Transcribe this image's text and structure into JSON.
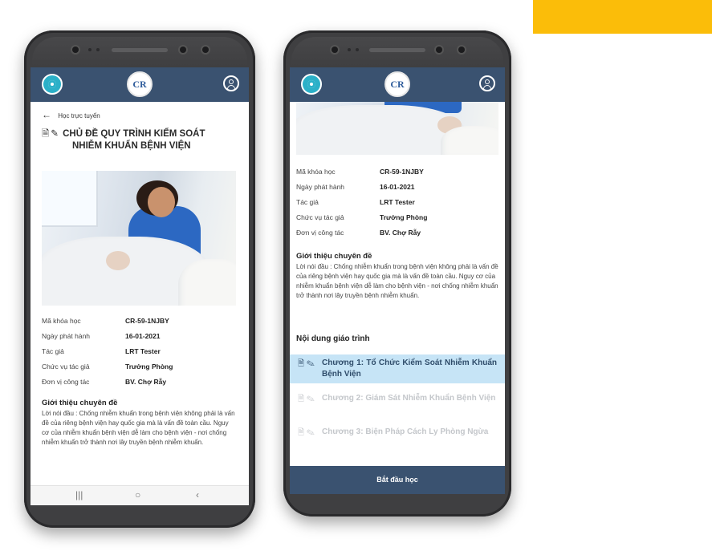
{
  "colors": {
    "accent": "#fbbd09",
    "header": "#3a5270",
    "active_chapter": "#c6e4f6"
  },
  "logo_center_text": "CR",
  "left_screen": {
    "back_label": "Học trực tuyến",
    "title_line1": "CHỦ ĐỀ QUY TRÌNH KIỂM SOÁT",
    "title_line2": "NHIỄM KHUẨN BỆNH VIỆN",
    "info": [
      {
        "label": "Mã khóa học",
        "value": "CR-59-1NJBY"
      },
      {
        "label": "Ngày phát hành",
        "value": "16-01-2021"
      },
      {
        "label": "Tác giả",
        "value": "LRT Tester"
      },
      {
        "label": "Chức vụ tác giả",
        "value": "Trưởng Phòng"
      },
      {
        "label": "Đơn vị công tác",
        "value": "BV. Chợ Rẫy"
      }
    ],
    "intro_heading": "Giới thiệu chuyên đề",
    "intro_text": "Lời nói đầu : Chống nhiễm khuẩn trong bệnh viện không phải là vấn đề của riêng bệnh viện hay quốc gia mà là vấn đề toàn cầu. Nguy cơ của nhiễm khuẩn bệnh viện dễ làm cho bệnh viện - nơi chống nhiễm khuẩn trở thành nơi lây truyền bệnh nhiễm khuẩn.",
    "nav": {
      "recent": "|||",
      "home": "○",
      "back": "‹"
    }
  },
  "right_screen": {
    "info": [
      {
        "label": "Mã khóa học",
        "value": "CR-59-1NJBY"
      },
      {
        "label": "Ngày phát hành",
        "value": "16-01-2021"
      },
      {
        "label": "Tác giả",
        "value": "LRT Tester"
      },
      {
        "label": "Chức vụ tác giả",
        "value": "Trưởng Phòng"
      },
      {
        "label": "Đơn vị công tác",
        "value": "BV. Chợ Rẫy"
      }
    ],
    "intro_heading": "Giới thiệu chuyên đề",
    "intro_text": "Lời nói đầu : Chống nhiễm khuẩn trong bệnh viện không phải là vấn đề của riêng bệnh viện hay quốc gia mà là vấn đề toàn cầu. Nguy cơ của nhiễm khuẩn bệnh viện dễ làm cho bệnh viện - nơi chống nhiễm khuẩn trở thành nơi lây truyền bệnh nhiễm khuẩn.",
    "syllabus_heading": "Nội dung giáo trình",
    "chapters": [
      {
        "label": "Chương 1: Tổ Chức Kiểm Soát Nhiễm Khuẩn Bệnh Viện",
        "state": "active"
      },
      {
        "label": "Chương 2: Giám Sát Nhiễm Khuẩn Bệnh Viện",
        "state": "disabled"
      },
      {
        "label": "Chương 3: Biện Pháp Cách Ly Phòng Ngừa",
        "state": "disabled"
      }
    ],
    "start_button": "Bắt đầu học"
  }
}
